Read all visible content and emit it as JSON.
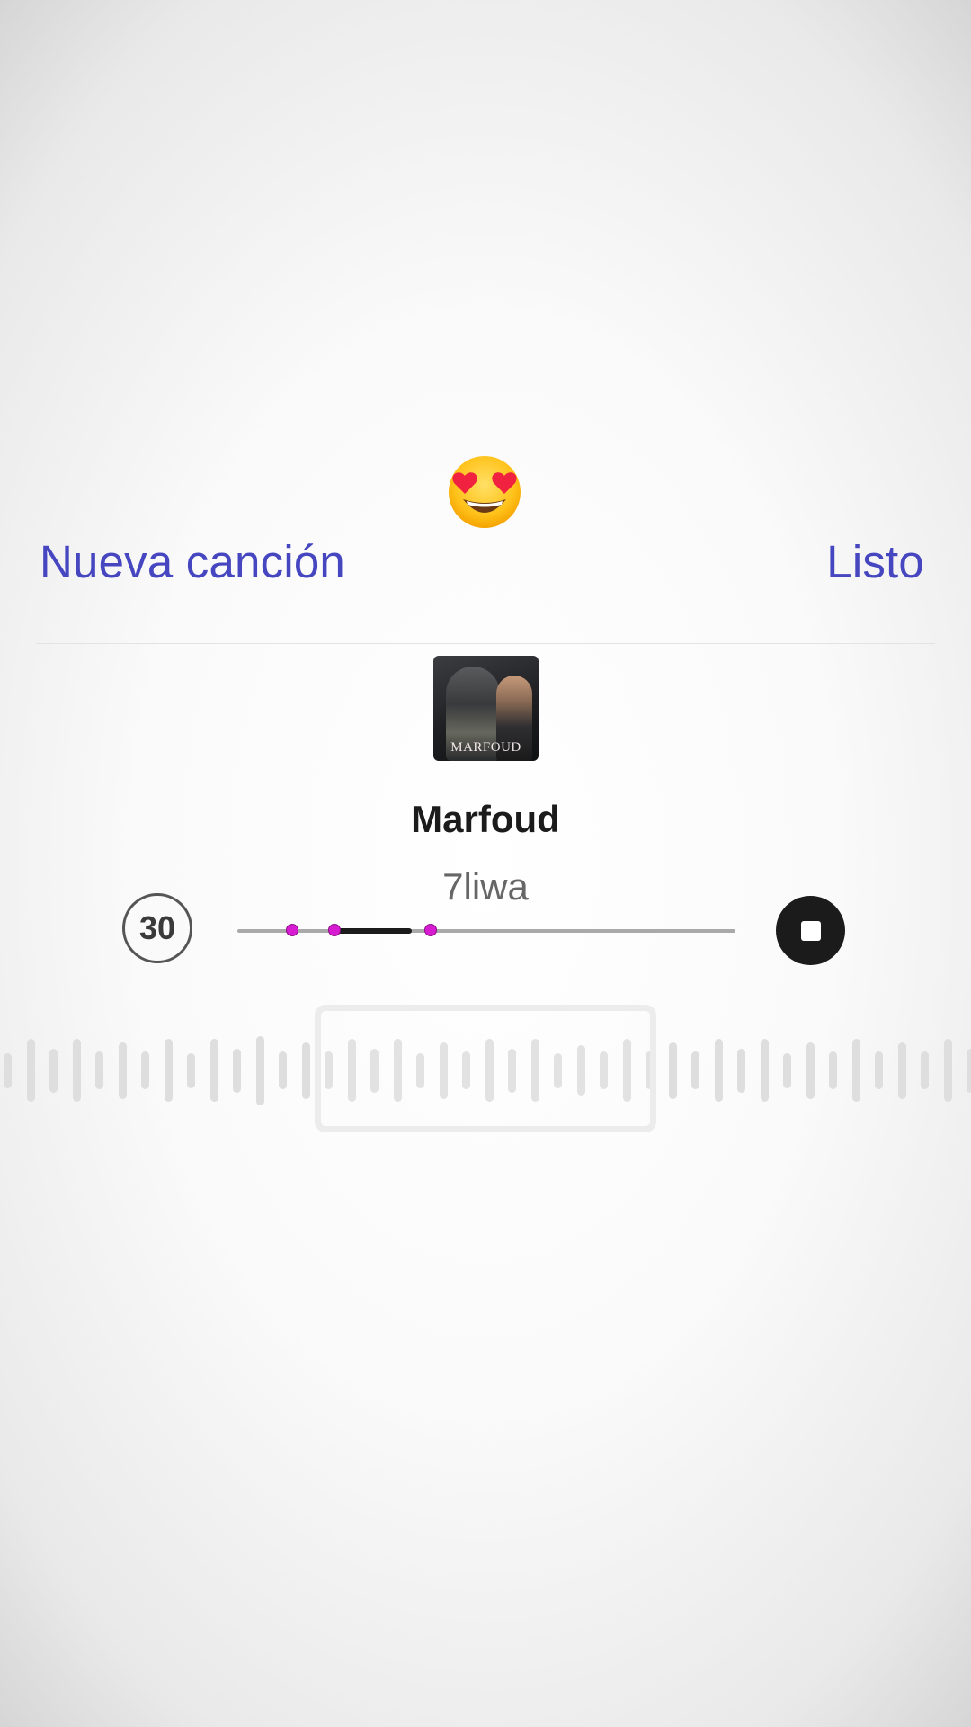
{
  "reaction": {
    "emoji": "😍",
    "icon": "heart-eyes-emoji"
  },
  "header": {
    "new_song_label": "Nueva canción",
    "done_label": "Listo",
    "accent_color": "#4646c0"
  },
  "song": {
    "cover_text": "MARFOUD",
    "title": "Marfoud",
    "artist": "7liwa"
  },
  "player": {
    "duration_label": "30",
    "stop_icon": "stop-icon",
    "selection_start": 0.195,
    "selection_end": 0.35,
    "marker_positions": [
      0.11,
      0.195,
      0.388
    ],
    "marker_color": "#d61bd0"
  },
  "waveform": {
    "bar_heights": [
      0.28,
      0.5,
      0.35,
      0.5,
      0.3,
      0.45,
      0.3,
      0.5,
      0.28,
      0.5,
      0.35,
      0.55,
      0.3,
      0.45,
      0.3,
      0.5,
      0.35,
      0.5,
      0.28,
      0.45,
      0.3,
      0.5,
      0.35,
      0.5,
      0.28,
      0.4,
      0.3,
      0.5,
      0.3,
      0.45,
      0.3,
      0.5,
      0.35,
      0.5,
      0.28,
      0.45,
      0.3,
      0.5,
      0.3,
      0.45,
      0.3,
      0.5,
      0.35
    ]
  }
}
